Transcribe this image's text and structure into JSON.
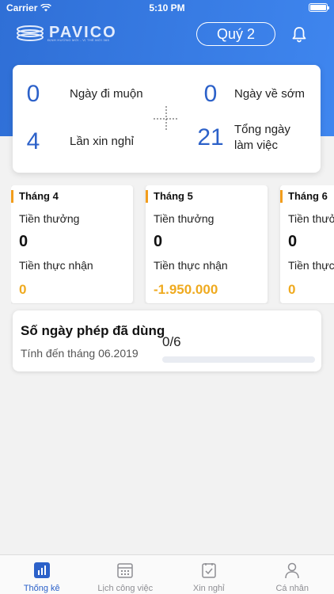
{
  "status_bar": {
    "carrier": "Carrier",
    "time": "5:10 PM"
  },
  "header": {
    "logo_text": "PAVICO",
    "logo_tagline": "ĐỊNH HƯỚNG MỚI - VỊ THẾ MỚI 365",
    "quarter_label": "Quý 2",
    "icons": [
      "bell-icon"
    ]
  },
  "summary": [
    {
      "value": "0",
      "label": "Ngày đi muộn"
    },
    {
      "value": "4",
      "label": "Lần xin nghỉ"
    },
    {
      "value": "0",
      "label": "Ngày về sớm"
    },
    {
      "value": "21",
      "label_line1": "Tổng ngày",
      "label_line2": "làm việc"
    }
  ],
  "months": [
    {
      "title": "Tháng 4",
      "bonus_label": "Tiền thưởng",
      "bonus_value": "0",
      "net_label": "Tiền thực nhận",
      "net_value": "0"
    },
    {
      "title": "Tháng 5",
      "bonus_label": "Tiền thưởng",
      "bonus_value": "0",
      "net_label": "Tiền thực nhận",
      "net_value": "-1.950.000"
    },
    {
      "title": "Tháng 6",
      "bonus_label": "Tiền thưởng",
      "bonus_value": "0",
      "net_label": "Tiền thực nhận",
      "net_value": "0"
    }
  ],
  "leave": {
    "title": "Số ngày phép đã dùng",
    "subtitle": "Tính đến tháng 06.2019",
    "count": "0/6",
    "used_fraction": 0
  },
  "tabs": [
    {
      "label": "Thống kê",
      "icon": "chart-icon",
      "active": true
    },
    {
      "label": "Lịch công việc",
      "icon": "calendar-icon",
      "active": false
    },
    {
      "label": "Xin nghỉ",
      "icon": "checklist-icon",
      "active": false
    },
    {
      "label": "Cá nhân",
      "icon": "user-icon",
      "active": false
    }
  ],
  "colors": {
    "primary": "#2c61c9",
    "accent": "#f29d1c",
    "money": "#efaa1f"
  }
}
